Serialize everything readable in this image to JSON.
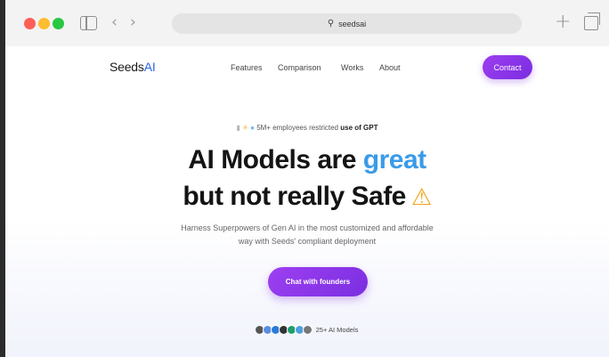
{
  "browser": {
    "address": "seedsai"
  },
  "nav": {
    "logo_main": "Seeds",
    "logo_accent": "AI",
    "links": [
      "Features",
      "Comparison",
      "Works",
      "About"
    ],
    "contact_label": "Contact"
  },
  "hero": {
    "badge_prefix": "5M+ employees restricted ",
    "badge_strong": "use of GPT",
    "headline_line1_prefix": "AI Models are ",
    "headline_line1_highlight": "great",
    "headline_line2": "but not really Safe",
    "warning_glyph": "⚠",
    "subtitle_line1": "Harness Superpowers of Gen AI in the most customized and affordable",
    "subtitle_line2": "way with Seeds' compliant deployment",
    "cta_label": "Chat with founders",
    "models_label": "25+ AI Models"
  },
  "colors": {
    "accent_purple": "#8b35ea",
    "accent_blue": "#3a9be8",
    "warning": "#f2a51c"
  },
  "icons": {
    "models": [
      "#555555",
      "#5a8de6",
      "#2a7bd8",
      "#333333",
      "#1f9e6e",
      "#4ea0e0",
      "#777777"
    ]
  }
}
